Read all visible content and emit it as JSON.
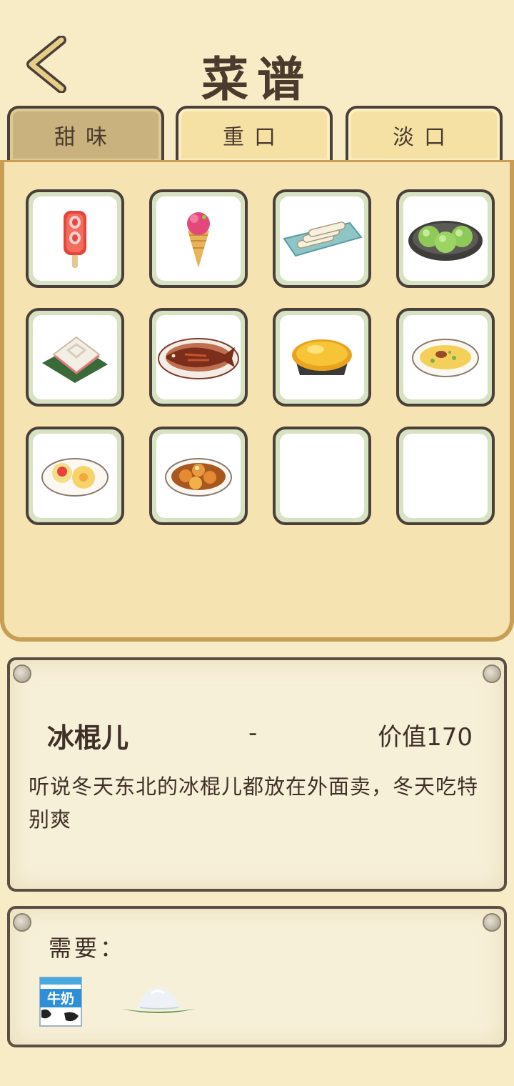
{
  "header": {
    "title": "菜谱",
    "back_icon": "chevron-left-icon"
  },
  "tabs": [
    {
      "label": "甜味",
      "active": true
    },
    {
      "label": "重口",
      "active": false
    },
    {
      "label": "淡口",
      "active": false
    }
  ],
  "recipes": [
    {
      "icon": "popsicle-icon"
    },
    {
      "icon": "ice-cream-cone-icon"
    },
    {
      "icon": "rice-rolls-plate-icon"
    },
    {
      "icon": "green-rice-balls-icon"
    },
    {
      "icon": "rice-cake-on-leaf-icon"
    },
    {
      "icon": "braised-fish-icon"
    },
    {
      "icon": "custard-tart-icon"
    },
    {
      "icon": "egg-pancake-icon"
    },
    {
      "icon": "pastry-plate-icon"
    },
    {
      "icon": "fried-balls-plate-icon"
    },
    {
      "icon": ""
    },
    {
      "icon": ""
    }
  ],
  "selected": {
    "name": "冰棍儿",
    "dash": "-",
    "value": "价值170",
    "description": "听说冬天东北的冰棍儿都放在外面卖，冬天吃特别爽"
  },
  "requirements": {
    "label": "需要：",
    "ingredients": [
      {
        "icon": "milk-carton-icon",
        "text": "牛奶"
      },
      {
        "icon": "sugar-pile-icon"
      }
    ]
  },
  "colors": {
    "background": "#f8ecc6",
    "panel": "#f6e3b2",
    "panel_border": "#c89e56",
    "slot_border": "#4b4039",
    "slot_fill": "#d7e2c2",
    "tab_active": "#c9b27d",
    "tab_inactive": "#f6e1a4"
  }
}
